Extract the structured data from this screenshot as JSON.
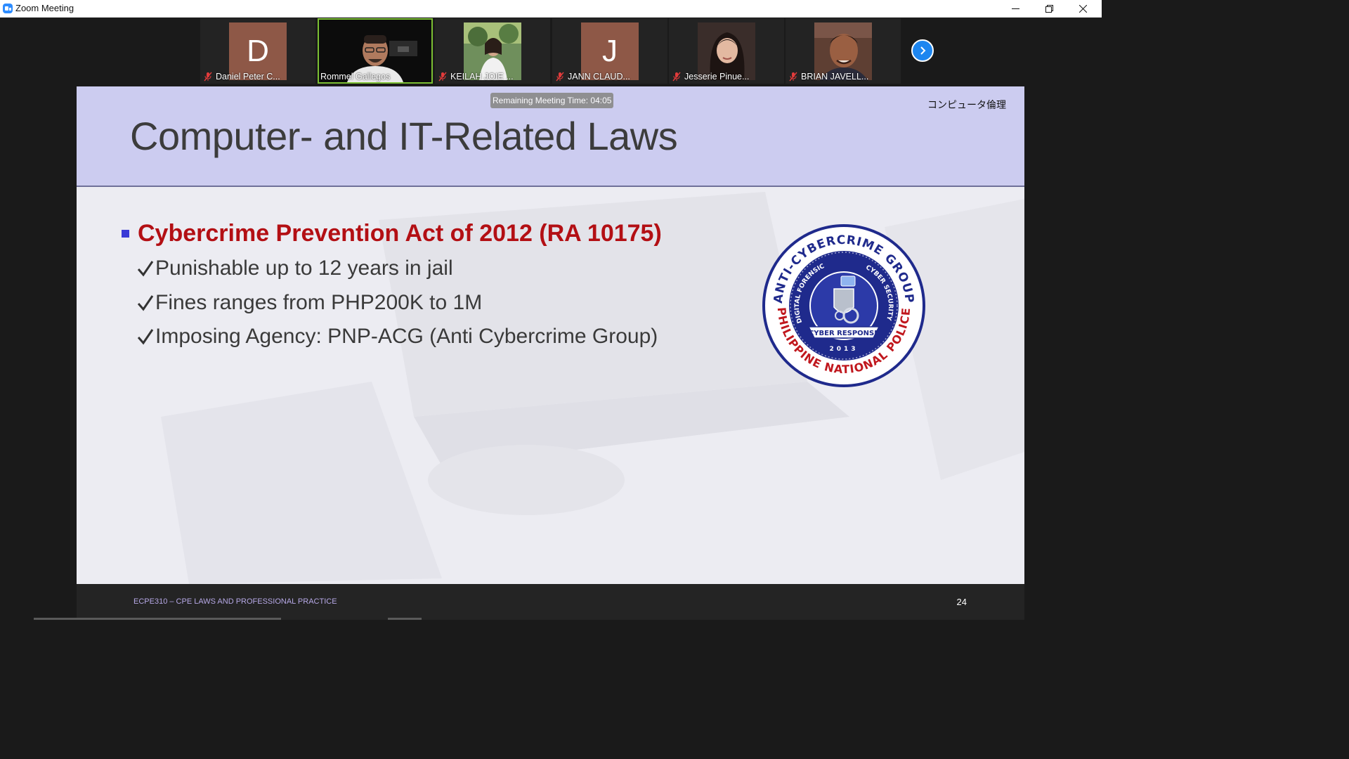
{
  "window": {
    "title": "Zoom Meeting",
    "controls": [
      "minimize-icon",
      "restore-icon",
      "close-icon"
    ]
  },
  "participants": [
    {
      "name": "Daniel Peter C...",
      "initial": "D",
      "muted": true,
      "type": "avatar",
      "avatar_color": "#8e5847"
    },
    {
      "name": "Rommel Gallegos",
      "muted": false,
      "type": "video",
      "active_speaker": true
    },
    {
      "name": "KEILAH JOIE ...",
      "muted": true,
      "type": "photo"
    },
    {
      "name": "JANN CLAUD...",
      "initial": "J",
      "muted": true,
      "type": "avatar",
      "avatar_color": "#8e5847"
    },
    {
      "name": "Jesserie Pinue...",
      "muted": true,
      "type": "photo"
    },
    {
      "name": "BRIAN JAVELL...",
      "muted": true,
      "type": "photo"
    }
  ],
  "strip_controls": {
    "next_icon": "chevron-right-icon"
  },
  "meeting": {
    "remaining_time": "Remaining Meeting Time: 04:05"
  },
  "slide": {
    "tag": "コンピュータ倫理",
    "title": "Computer- and IT-Related Laws",
    "main_bullet": "Cybercrime Prevention Act of 2012 (RA 10175)",
    "sub_items": [
      "Punishable up to 12 years in jail",
      "Fines ranges from PHP200K to 1M",
      "Imposing Agency:  PNP-ACG (Anti Cybercrime Group)"
    ],
    "seal": {
      "outer_text_top": "ANTI-CYBERCRIME GROUP",
      "outer_text_bottom": "PHILIPPINE NATIONAL POLICE",
      "inner_text_left": "DIGITAL FORENSIC",
      "inner_text_right": "CYBER SECURITY",
      "banner": "CYBER RESPONSE",
      "year": "2013"
    },
    "footer_course": "ECPE310 – CPE LAWS AND PROFESSIONAL PRACTICE",
    "page_number": "24"
  },
  "colors": {
    "header_band": "#ccccf0",
    "title_text": "#3c3c3c",
    "main_bullet_text": "#b30f14",
    "bullet_square": "#3a3ad6",
    "active_speaker_border": "#7bbf33",
    "next_button": "#1d86f0",
    "seal_blue": "#1f2a8c",
    "seal_red": "#c0171d"
  }
}
